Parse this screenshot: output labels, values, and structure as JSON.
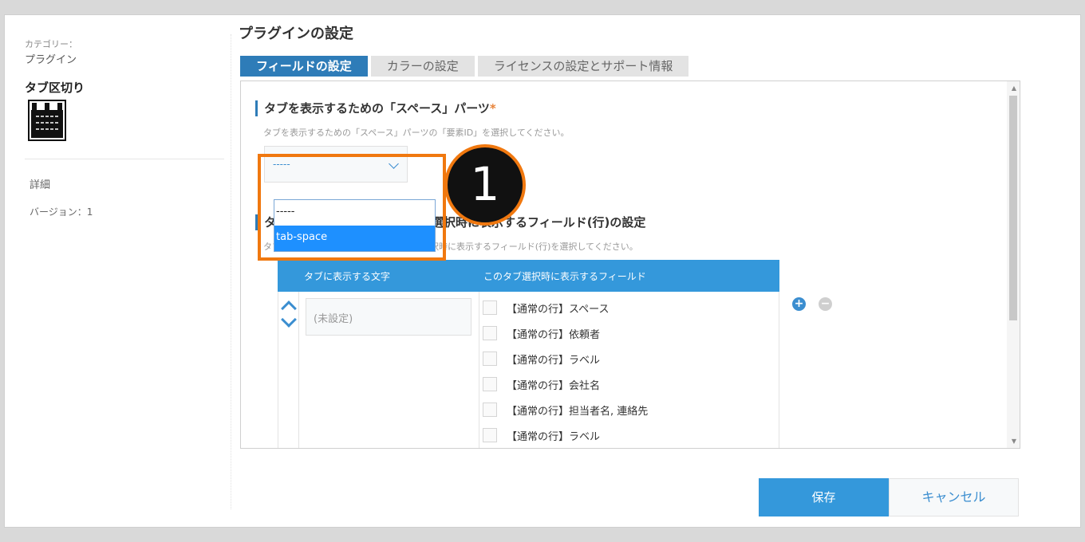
{
  "sidebar": {
    "category_label": "カテゴリー：",
    "category_value": "プラグイン",
    "plugin_name": "タブ区切り",
    "detail_link": "詳細",
    "version": "バージョン：1"
  },
  "page": {
    "title": "プラグインの設定"
  },
  "tabs": [
    {
      "label": "フィールドの設定",
      "active": true
    },
    {
      "label": "カラーの設定",
      "active": false
    },
    {
      "label": "ライセンスの設定とサポート情報",
      "active": false
    }
  ],
  "section1": {
    "title": "タブを表示するための「スペース」パーツ",
    "required_mark": "*",
    "description": "タブを表示するための「スペース」パーツの「要素ID」を選択してください。",
    "select_value": "-----"
  },
  "dropdown": {
    "options": [
      "-----",
      "tab-space"
    ],
    "highlighted": "tab-space"
  },
  "section2": {
    "title": "タブに表示する文字とこのタブ選択時に表示するフィールド(行)の設定",
    "description": "タブに表示する文字を入力し、このタブ選択時に表示するフィールド(行)を選択してください。"
  },
  "table": {
    "headers": [
      "タブに表示する文字",
      "このタブ選択時に表示するフィールド"
    ],
    "tab_text_placeholder": "(未設定)",
    "fields": [
      "【通常の行】スペース",
      "【通常の行】依頼者",
      "【通常の行】ラベル",
      "【通常の行】会社名",
      "【通常の行】担当者名, 連絡先",
      "【通常の行】ラベル"
    ]
  },
  "annotation": {
    "number": "1",
    "color": "#f0780f"
  },
  "buttons": {
    "save": "保存",
    "cancel": "キャンセル"
  },
  "colors": {
    "accent": "#3498db",
    "active_tab": "#2e7cb8"
  }
}
